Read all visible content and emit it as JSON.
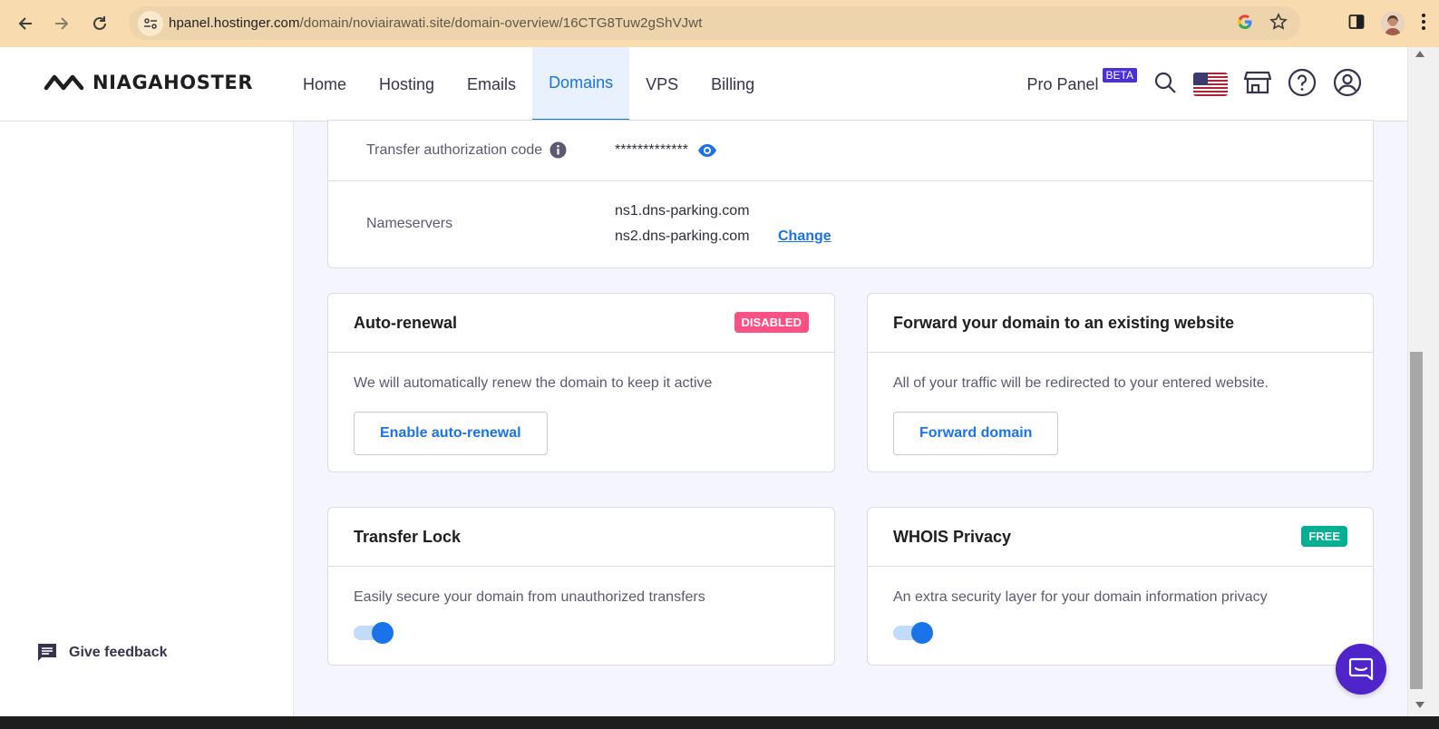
{
  "browser": {
    "url_host": "hpanel.hostinger.com",
    "url_path": "/domain/noviairawati.site/domain-overview/16CTG8Tuw2gShVJwt"
  },
  "topnav": {
    "logo_text": "NIAGAHOSTER",
    "menu": [
      {
        "label": "Home",
        "active": false
      },
      {
        "label": "Hosting",
        "active": false
      },
      {
        "label": "Emails",
        "active": false
      },
      {
        "label": "Domains",
        "active": true
      },
      {
        "label": "VPS",
        "active": false
      },
      {
        "label": "Billing",
        "active": false
      }
    ],
    "pro_panel_label": "Pro Panel",
    "beta_label": "BETA"
  },
  "sidebar": {
    "feedback_label": "Give feedback"
  },
  "domain_info": {
    "transfer_code_label": "Transfer authorization code",
    "transfer_code_value": "*************",
    "nameservers_label": "Nameservers",
    "nameservers": [
      "ns1.dns-parking.com",
      "ns2.dns-parking.com"
    ],
    "change_link": "Change"
  },
  "cards": {
    "auto_renewal": {
      "title": "Auto-renewal",
      "badge": "DISABLED",
      "badge_color": "#fc5185",
      "description": "We will automatically renew the domain to keep it active",
      "button": "Enable auto-renewal"
    },
    "forward": {
      "title": "Forward your domain to an existing website",
      "description": "All of your traffic will be redirected to your entered website.",
      "button": "Forward domain"
    },
    "transfer_lock": {
      "title": "Transfer Lock",
      "description": "Easily secure your domain from unauthorized transfers",
      "enabled": true
    },
    "whois": {
      "title": "WHOIS Privacy",
      "badge": "FREE",
      "badge_color": "#00b090",
      "description": "An extra security layer for your domain information privacy",
      "enabled": true
    }
  },
  "colors": {
    "accent": "#1a73e8",
    "chat": "#4f24c9"
  }
}
